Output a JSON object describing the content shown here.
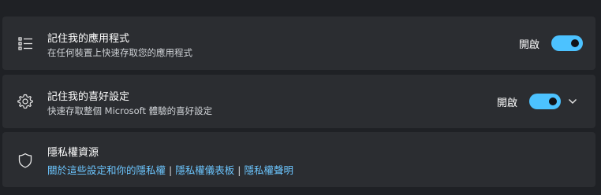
{
  "settings": [
    {
      "title": "記住我的應用程式",
      "subtitle": "在任何裝置上快速存取您的應用程式",
      "state": "開啟",
      "icon": "list-icon",
      "toggle_on": true
    },
    {
      "title": "記住我的喜好設定",
      "subtitle": "快速存取整個 Microsoft 體驗的喜好設定",
      "state": "開啟",
      "icon": "gear-icon",
      "toggle_on": true,
      "expandable": true
    }
  ],
  "privacy": {
    "title": "隱私權資源",
    "icon": "shield-icon",
    "links": [
      "關於這些設定和你的隱私權",
      "隱私權儀表板",
      "隱私權聲明"
    ],
    "separator": "|"
  },
  "colors": {
    "accent": "#4cc2ff",
    "link": "#6cc6ff",
    "card": "#2b2d31",
    "background": "#1f2125"
  }
}
